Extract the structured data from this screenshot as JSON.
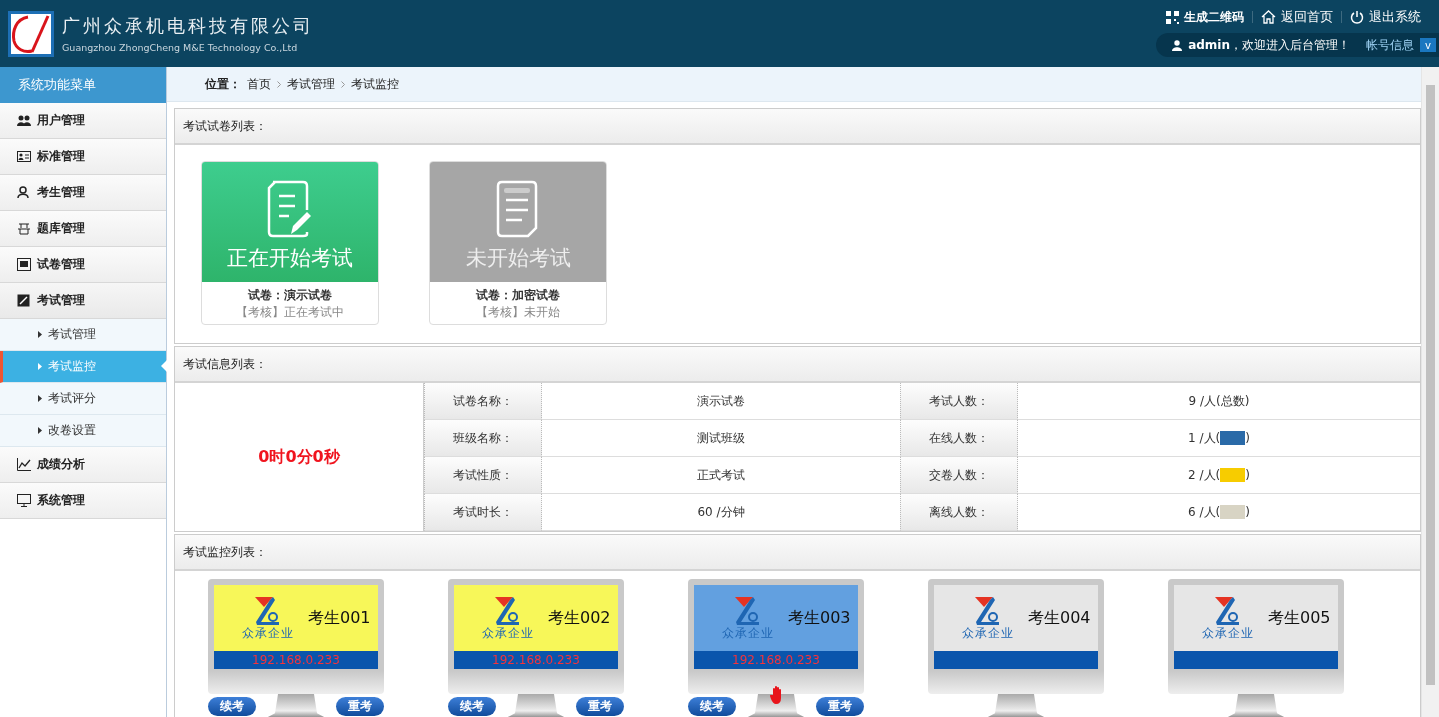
{
  "header": {
    "company_name": "广州众承机电科技有限公司",
    "company_name_en": "Guangzhou ZhongCheng M&E Technology Co.,Ltd",
    "links": [
      "生成二维码",
      "返回首页",
      "退出系统"
    ],
    "user": "admin",
    "welcome": "，欢迎进入后台管理！",
    "account": "帐号信息",
    "account_caret": "v"
  },
  "sidebar": {
    "title": "系统功能菜单",
    "items": [
      {
        "label": "用户管理"
      },
      {
        "label": "标准管理"
      },
      {
        "label": "考生管理"
      },
      {
        "label": "题库管理"
      },
      {
        "label": "试卷管理"
      },
      {
        "label": "考试管理",
        "children": [
          {
            "label": "考试管理",
            "selected": false
          },
          {
            "label": "考试监控",
            "selected": true
          },
          {
            "label": "考试评分",
            "selected": false
          },
          {
            "label": "改卷设置",
            "selected": false
          }
        ]
      },
      {
        "label": "成绩分析"
      },
      {
        "label": "系统管理"
      }
    ]
  },
  "breadcrumb": {
    "label": "位置：",
    "items": [
      "首页",
      "考试管理",
      "考试监控"
    ]
  },
  "paper_list": {
    "title": "考试试卷列表：",
    "papers": [
      {
        "kind": "running",
        "status_title": "正在开始考试",
        "paper": "试卷：演示试卷",
        "tag": "【考核】",
        "state": "正在考试中"
      },
      {
        "kind": "idle",
        "status_title": "未开始考试",
        "paper": "试卷：加密试卷",
        "tag": "【考核】",
        "state": "未开始"
      }
    ]
  },
  "exam_info": {
    "title": "考试信息列表：",
    "timer": "0时0分0秒",
    "rows": [
      {
        "label": "试卷名称：",
        "value": "演示试卷",
        "label_2": "考试人数：",
        "count": "9 /人(总数)"
      },
      {
        "label": "班级名称：",
        "value": "测试班级",
        "label_2": "在线人数：",
        "count": "1 /人(",
        "color": "#2a6aa8",
        "close": ")"
      },
      {
        "label": "考试性质：",
        "value": "正式考试",
        "label_2": "交卷人数：",
        "count": "2 /人(",
        "color": "#f7cc00",
        "close": ")"
      },
      {
        "label": "考试时长：",
        "value": "60 /分钟",
        "label_2": "离线人数：",
        "count": "6 /人(",
        "color": "#d8d4c4",
        "close": ")"
      }
    ]
  },
  "monitor": {
    "title": "考试监控列表：",
    "students": [
      {
        "name": "考生001",
        "logo_text": "众承企业",
        "color": "#f7f759",
        "ip": "192.168.0.233",
        "hand_raised": false,
        "buttons": [
          "续考",
          "重考"
        ]
      },
      {
        "name": "考生002",
        "logo_text": "众承企业",
        "color": "#f7f759",
        "ip": "192.168.0.233",
        "hand_raised": false,
        "buttons": [
          "续考",
          "重考"
        ]
      },
      {
        "name": "考生003",
        "logo_text": "众承企业",
        "color": "#62a0e0",
        "ip": "192.168.0.233",
        "hand_raised": true,
        "buttons": [
          "续考",
          "重考"
        ]
      },
      {
        "name": "考生004",
        "logo_text": "众承企业",
        "color": "#e6e6e6",
        "hand_raised": false
      },
      {
        "name": "考生005",
        "logo_text": "众承企业",
        "color": "#e6e6e6",
        "hand_raised": false
      }
    ]
  }
}
